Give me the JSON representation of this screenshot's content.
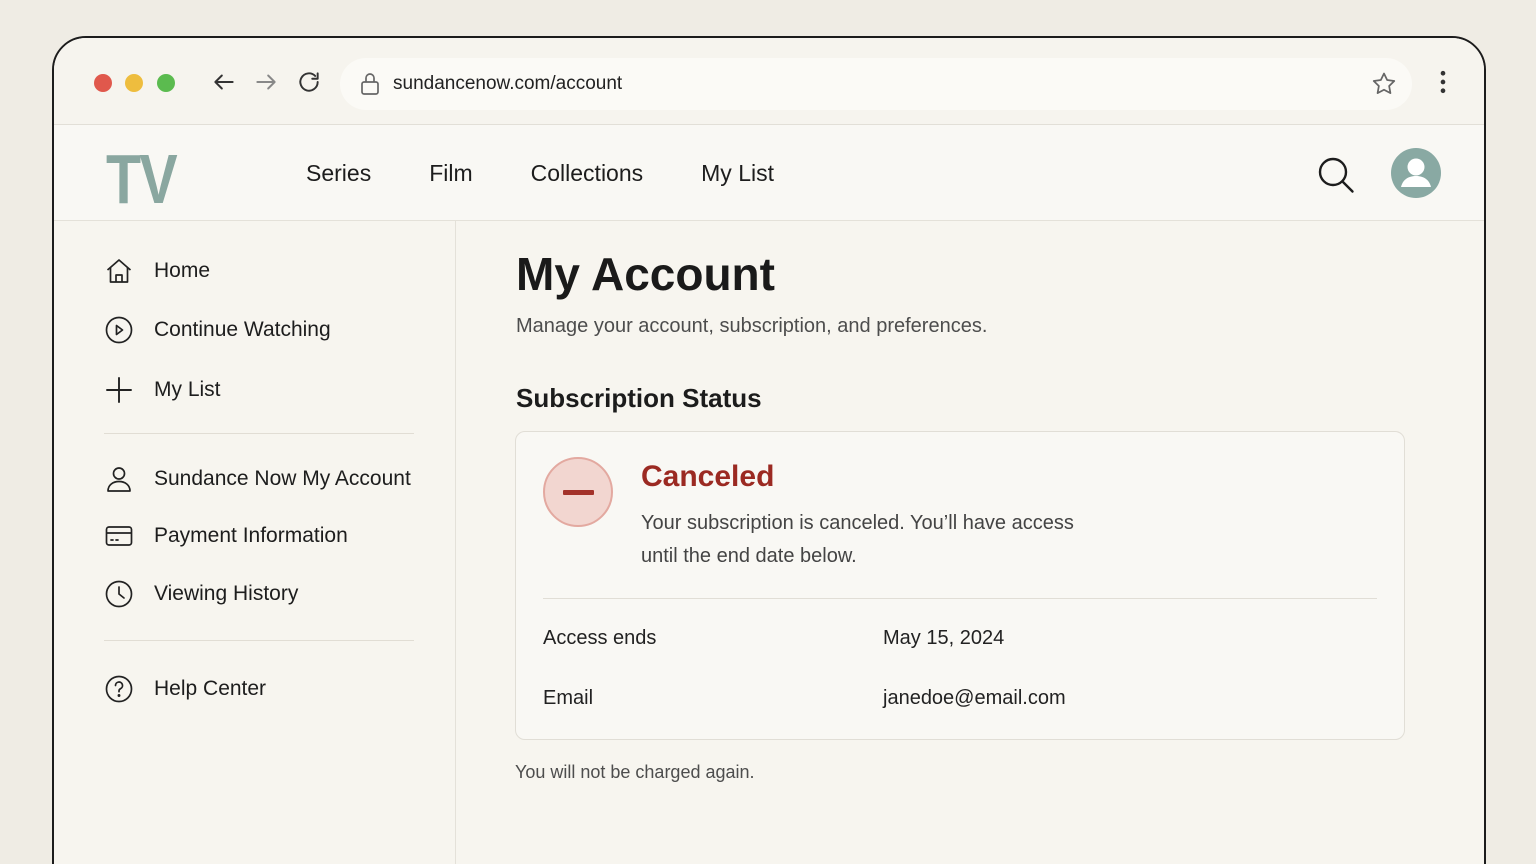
{
  "browser": {
    "url": "sundancenow.com/account"
  },
  "header": {
    "logo": "TV",
    "nav": [
      "Series",
      "Film",
      "Collections",
      "My List"
    ]
  },
  "sidebar": {
    "group1": [
      {
        "label": "Home",
        "icon": "home-icon"
      },
      {
        "label": "Continue Watching",
        "icon": "play-circle-icon"
      },
      {
        "label": "My List",
        "icon": "plus-icon"
      }
    ],
    "group2": [
      {
        "label": "Sundance Now My Account",
        "icon": "user-icon"
      },
      {
        "label": "Payment Information",
        "icon": "credit-card-icon"
      },
      {
        "label": "Viewing History",
        "icon": "clock-icon"
      }
    ],
    "group3": [
      {
        "label": "Help Center",
        "icon": "help-circle-icon"
      }
    ]
  },
  "main": {
    "title": "My Account",
    "subtitle": "Manage your account, subscription, and preferences.",
    "section_title": "Subscription Status",
    "status": {
      "title": "Canceled",
      "description": "Your subscription is canceled. You’ll have access until the end date below.",
      "color": "#9b2a22"
    },
    "details": [
      {
        "label": "Access ends",
        "value": "May 15, 2024"
      },
      {
        "label": "Email",
        "value": "janedoe@email.com"
      }
    ],
    "footnote": "You will not be charged again."
  },
  "colors": {
    "accent": "#89a9a3",
    "status_bg": "#f2d6d0"
  }
}
